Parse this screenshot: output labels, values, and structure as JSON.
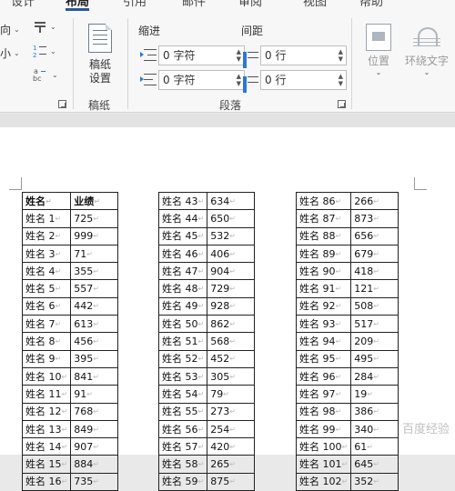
{
  "ribbon": {
    "tabs": [
      "设计",
      "布局",
      "引用",
      "邮件",
      "审阅",
      "视图",
      "帮助"
    ],
    "active_tab": "布局",
    "left_buttons": [
      {
        "label": "向",
        "caret": "⌄"
      },
      {
        "label": "小",
        "caret": "⌄"
      }
    ],
    "gaozhi": {
      "line1": "稿纸",
      "line2": "设置",
      "group": "稿纸"
    },
    "paragraph": {
      "indent_title": "缩进",
      "spacing_title": "间距",
      "indent_left": "0 字符",
      "indent_right": "0 字符",
      "spacing_before": "0 行",
      "spacing_after": "0 行",
      "group": "段落"
    },
    "arrange": {
      "position": "位置",
      "wrap_text": "环绕文字",
      "caret": "⌄"
    }
  },
  "tables": [
    {
      "header": [
        "姓名",
        "业绩"
      ],
      "rows": [
        [
          "姓名 1",
          "725"
        ],
        [
          "姓名 2",
          "999"
        ],
        [
          "姓名 3",
          "71"
        ],
        [
          "姓名 4",
          "355"
        ],
        [
          "姓名 5",
          "557"
        ],
        [
          "姓名 6",
          "442"
        ],
        [
          "姓名 7",
          "613"
        ],
        [
          "姓名 8",
          "456"
        ],
        [
          "姓名 9",
          "395"
        ],
        [
          "姓名 10",
          "841"
        ],
        [
          "姓名 11",
          "91"
        ],
        [
          "姓名 12",
          "768"
        ],
        [
          "姓名 13",
          "849"
        ],
        [
          "姓名 14",
          "907"
        ],
        [
          "姓名 15",
          "884"
        ],
        [
          "姓名 16",
          "735"
        ]
      ]
    },
    {
      "rows": [
        [
          "姓名 43",
          "634"
        ],
        [
          "姓名 44",
          "650"
        ],
        [
          "姓名 45",
          "532"
        ],
        [
          "姓名 46",
          "406"
        ],
        [
          "姓名 47",
          "904"
        ],
        [
          "姓名 48",
          "729"
        ],
        [
          "姓名 49",
          "928"
        ],
        [
          "姓名 50",
          "862"
        ],
        [
          "姓名 51",
          "568"
        ],
        [
          "姓名 52",
          "452"
        ],
        [
          "姓名 53",
          "305"
        ],
        [
          "姓名 54",
          "79"
        ],
        [
          "姓名 55",
          "273"
        ],
        [
          "姓名 56",
          "254"
        ],
        [
          "姓名 57",
          "420"
        ],
        [
          "姓名 58",
          "265"
        ],
        [
          "姓名 59",
          "875"
        ]
      ]
    },
    {
      "rows": [
        [
          "姓名 86",
          "266"
        ],
        [
          "姓名 87",
          "873"
        ],
        [
          "姓名 88",
          "656"
        ],
        [
          "姓名 89",
          "679"
        ],
        [
          "姓名 90",
          "418"
        ],
        [
          "姓名 91",
          "121"
        ],
        [
          "姓名 92",
          "508"
        ],
        [
          "姓名 93",
          "517"
        ],
        [
          "姓名 94",
          "209"
        ],
        [
          "姓名 95",
          "495"
        ],
        [
          "姓名 96",
          "284"
        ],
        [
          "姓名 97",
          "19"
        ],
        [
          "姓名 98",
          "386"
        ],
        [
          "姓名 99",
          "340"
        ],
        [
          "姓名 100",
          "61"
        ],
        [
          "姓名 101",
          "645"
        ],
        [
          "姓名 102",
          "352"
        ]
      ]
    }
  ],
  "watermark": "百度经验",
  "colors": {
    "accent": "#2b579a",
    "spinner_icon": "#2b79d6"
  }
}
